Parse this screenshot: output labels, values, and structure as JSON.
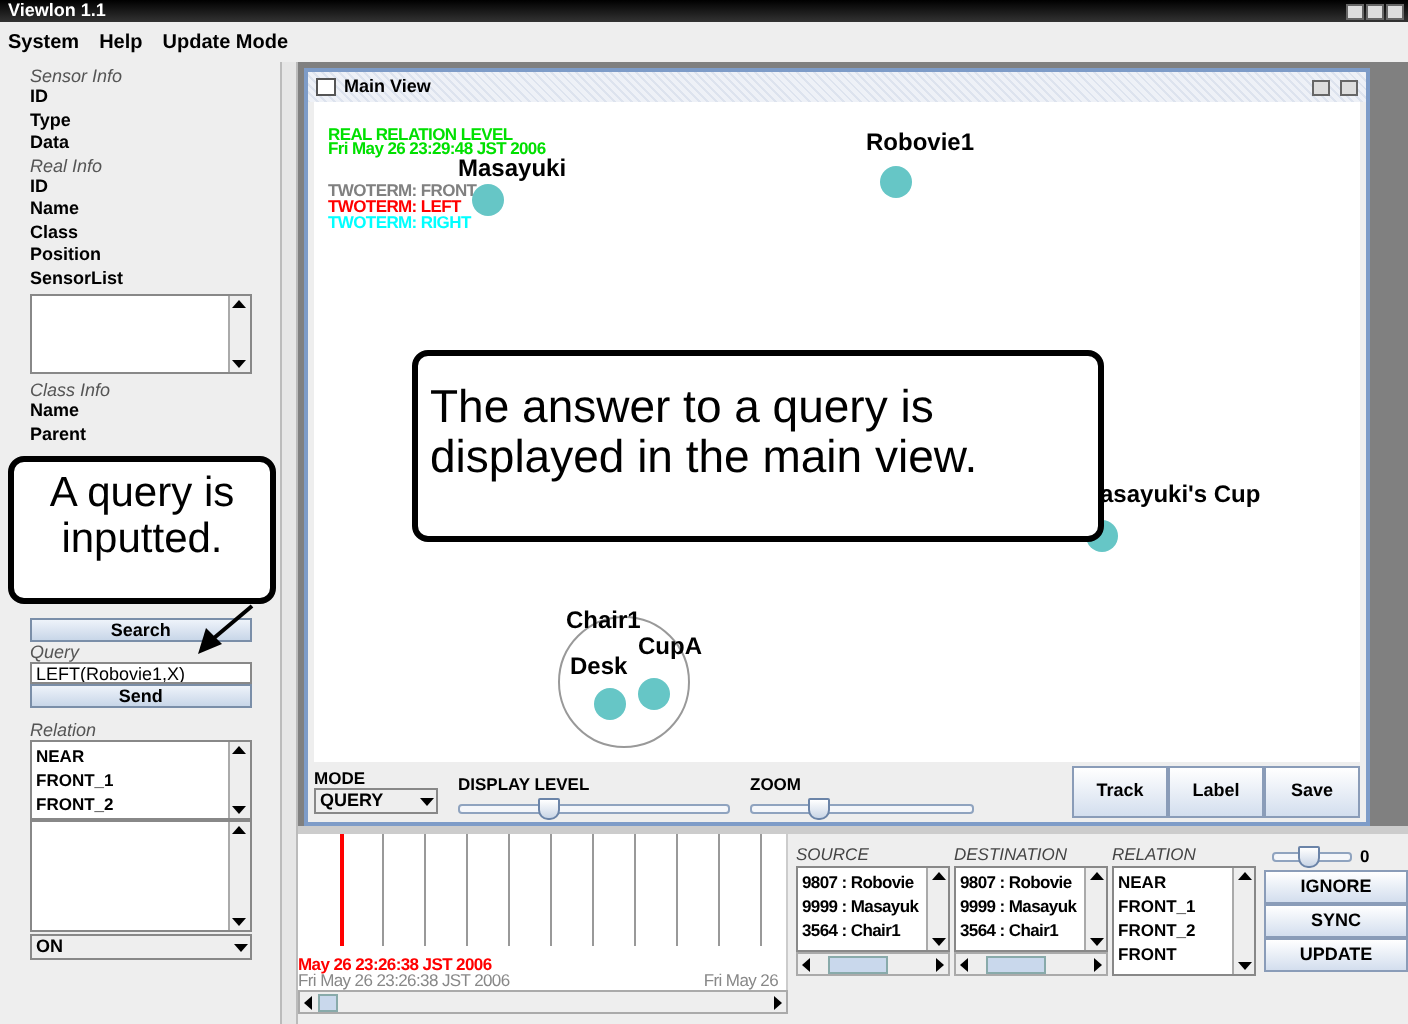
{
  "window": {
    "title": "Viewlon 1.1"
  },
  "menu": [
    "System",
    "Help",
    "Update Mode"
  ],
  "left_panel": {
    "sensor_info": {
      "heading": "Sensor Info",
      "fields": [
        "ID",
        "Type",
        "Data"
      ]
    },
    "real_info": {
      "heading": "Real Info",
      "fields": [
        "ID",
        "Name",
        "Class",
        "Position",
        "SensorList"
      ]
    },
    "class_info": {
      "heading": "Class Info",
      "fields": [
        "Name",
        "Parent"
      ]
    },
    "search_button": "Search",
    "query": {
      "label": "Query",
      "value": "LEFT(Robovie1,X)"
    },
    "send_button": "Send",
    "relation": {
      "label": "Relation",
      "items": [
        "NEAR",
        "FRONT_1",
        "FRONT_2"
      ]
    },
    "combo": "ON"
  },
  "main_view": {
    "title": "Main View",
    "overlay": {
      "heading": "REAL RELATION LEVEL",
      "time": "Fri May 26 23:29:48 JST 2006",
      "legend": [
        {
          "text": "TWOTERM: FRONT",
          "color": "#808080"
        },
        {
          "text": "TWOTERM: LEFT",
          "color": "#ff0000"
        },
        {
          "text": "TWOTERM: RIGHT",
          "color": "#00ffff"
        }
      ]
    },
    "nodes": [
      "Masayuki",
      "Robovie1",
      "asayuki's Cup",
      "Chair1",
      "Desk",
      "CupA"
    ],
    "mode": {
      "label": "MODE",
      "value": "QUERY"
    },
    "display_level": {
      "label": "DISPLAY LEVEL",
      "level": 0.33
    },
    "zoom": {
      "label": "ZOOM",
      "level": 0.3
    },
    "buttons": [
      "Track",
      "Label",
      "Save"
    ]
  },
  "timeline": {
    "marker": "May 26 23:26:38 JST 2006",
    "start": "Fri May 26 23:26:38 JST 2006",
    "end": "Fri May 26"
  },
  "relation_table": {
    "columns": [
      {
        "heading": "SOURCE",
        "items": [
          "9807 : Robovie",
          "9999 : Masayuk",
          "3564 : Chair1"
        ]
      },
      {
        "heading": "DESTINATION",
        "items": [
          "9807 : Robovie",
          "9999 : Masayuk",
          "3564 : Chair1"
        ]
      },
      {
        "heading": "RELATION",
        "items": [
          "NEAR",
          "FRONT_1",
          "FRONT_2",
          "FRONT"
        ]
      }
    ],
    "threshold": {
      "level": 0.45,
      "reading": "0"
    },
    "buttons": [
      "IGNORE",
      "SYNC",
      "UPDATE"
    ]
  },
  "callouts": [
    "A query is inputted.",
    "The answer to a query is displayed in the main view."
  ]
}
